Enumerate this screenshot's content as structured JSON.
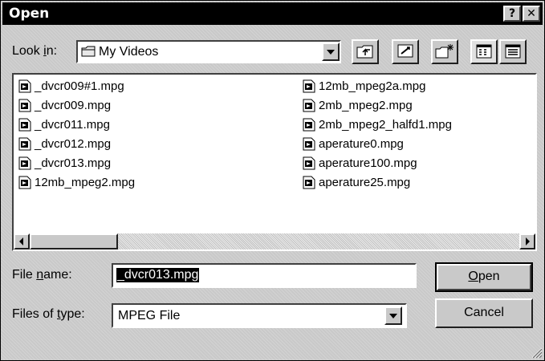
{
  "window": {
    "title": "Open",
    "help_label": "?",
    "close_label": "✕"
  },
  "look_in": {
    "label_pre": "Look ",
    "label_accel": "i",
    "label_post": "n:",
    "value": "My Videos",
    "icon": "folder-icon"
  },
  "toolbar": {
    "buttons": [
      "up-one-level-icon",
      "desktop-icon",
      "new-folder-icon",
      "list-view-icon",
      "details-view-icon"
    ]
  },
  "files": [
    "_dvcr009#1.mpg",
    "_dvcr009.mpg",
    "_dvcr011.mpg",
    "_dvcr012.mpg",
    "_dvcr013.mpg",
    "12mb_mpeg2.mpg",
    "12mb_mpeg2a.mpg",
    "2mb_mpeg2.mpg",
    "2mb_mpeg2_halfd1.mpg",
    "aperature0.mpg",
    "aperature100.mpg",
    "aperature25.mpg"
  ],
  "file_name": {
    "label_pre": "File ",
    "label_accel": "n",
    "label_post": "ame:",
    "value": "_dvcr013.mpg"
  },
  "file_type": {
    "label_pre": "Files of ",
    "label_accel": "t",
    "label_post": "ype:",
    "value": "MPEG File"
  },
  "buttons": {
    "open_accel": "O",
    "open_rest": "pen",
    "cancel": "Cancel"
  }
}
